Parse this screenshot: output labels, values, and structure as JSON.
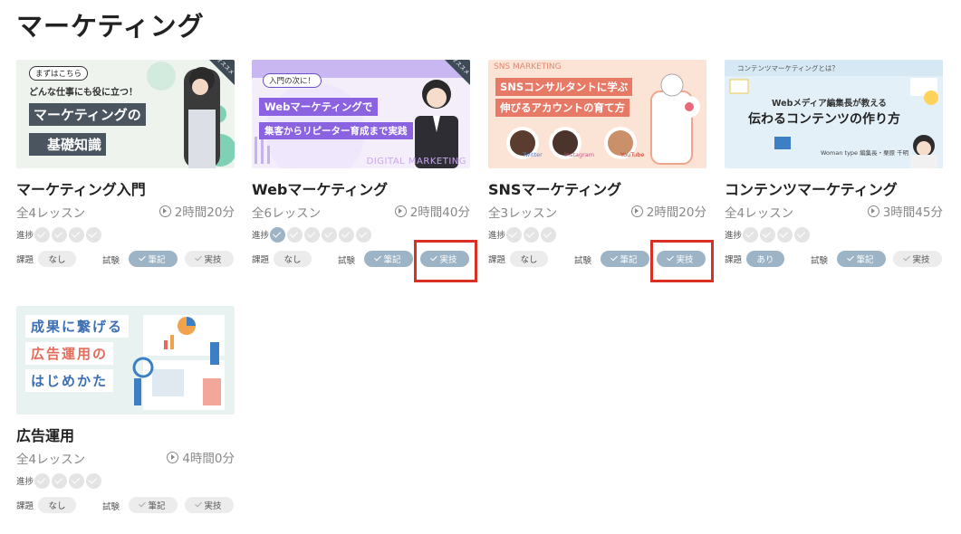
{
  "section": {
    "title": "マーケティング"
  },
  "labels": {
    "progress": "進捗",
    "task": "課題",
    "exam": "試験"
  },
  "courses": [
    {
      "title": "マーケティング入門",
      "lessons": "全4レッスン",
      "duration": "2時間20分",
      "progress_total": 4,
      "progress_done": 0,
      "task": "なし",
      "task_on": false,
      "exam1": "筆記",
      "exam1_done": true,
      "exam2": "実技",
      "exam2_done": false,
      "thumb": {
        "tag": "まずはこちら",
        "line1": "どんな仕事にも役に立つ！",
        "line2": "マーケティングの",
        "line3": "基礎知識",
        "ribbon": "オススメ"
      }
    },
    {
      "title": "Webマーケティング",
      "lessons": "全6レッスン",
      "duration": "2時間40分",
      "progress_total": 6,
      "progress_done": 1,
      "task": "なし",
      "task_on": false,
      "exam1": "筆記",
      "exam1_done": true,
      "exam2": "実技",
      "exam2_done": true,
      "thumb": {
        "tag": "入門の次に！",
        "line1": "Webマーケティングで",
        "line2": "集客からリピーター育成まで実践",
        "footer": "DIGITAL MARKETING",
        "ribbon": "オススメ"
      }
    },
    {
      "title": "SNSマーケティング",
      "lessons": "全3レッスン",
      "duration": "2時間20分",
      "progress_total": 3,
      "progress_done": 0,
      "task": "なし",
      "task_on": false,
      "exam1": "筆記",
      "exam1_done": true,
      "exam2": "実技",
      "exam2_done": true,
      "thumb": {
        "header": "SNS MARKETING",
        "line1": "SNSコンサルタントに学ぶ",
        "line2": "伸びるアカウントの育て方",
        "n1": "Twitter",
        "n2": "Instagram",
        "n3": "YouTube"
      }
    },
    {
      "title": "コンテンツマーケティング",
      "lessons": "全4レッスン",
      "duration": "3時間45分",
      "progress_total": 4,
      "progress_done": 0,
      "task": "あり",
      "task_on": true,
      "exam1": "筆記",
      "exam1_done": true,
      "exam2": "実技",
      "exam2_done": false,
      "thumb": {
        "tag": "コンテンツマーケティングとは？",
        "line1": "Webメディア編集長が教える",
        "line2": "伝わるコンテンツの作り方",
        "credit": "Woman type 編集長・栗原 千明"
      }
    },
    {
      "title": "広告運用",
      "lessons": "全4レッスン",
      "duration": "4時間0分",
      "progress_total": 4,
      "progress_done": 0,
      "task": "なし",
      "task_on": false,
      "exam1": "筆記",
      "exam1_done": false,
      "exam2": "実技",
      "exam2_done": false,
      "thumb": {
        "line1": "成果に繋げる",
        "line2": "広告運用の",
        "line3": "はじめかた"
      }
    }
  ],
  "colors": {
    "done": "#9db4c6",
    "pending": "#e4e4e4",
    "highlight": "#d93025"
  }
}
